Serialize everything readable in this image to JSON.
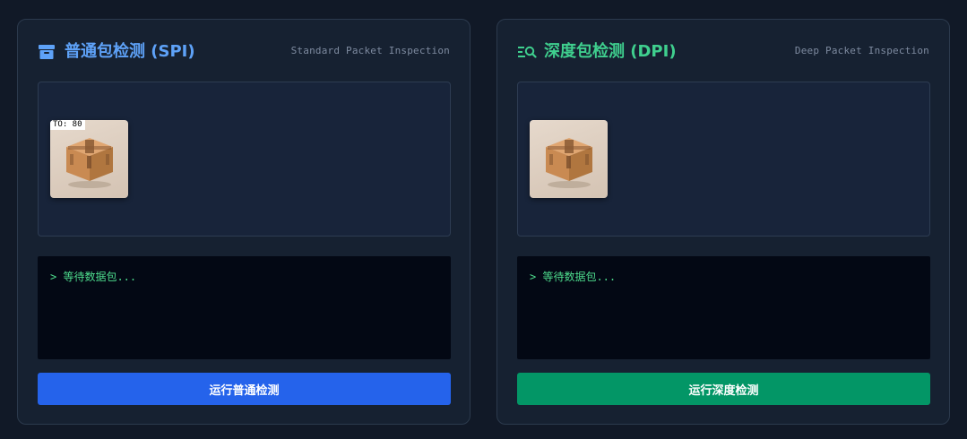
{
  "spi": {
    "title": "普通包检测 (SPI)",
    "subtitle": "Standard Packet Inspection",
    "icon": "archive-box-icon",
    "packet_tag": "TO: 80",
    "console_text": "> 等待数据包...",
    "button_label": "运行普通检测",
    "accent_color": "#5ea2f8",
    "button_color": "#2563eb"
  },
  "dpi": {
    "title": "深度包检测 (DPI)",
    "subtitle": "Deep Packet Inspection",
    "icon": "search-list-icon",
    "console_text": "> 等待数据包...",
    "button_label": "运行深度检测",
    "accent_color": "#3fcf8e",
    "button_color": "#039666"
  }
}
